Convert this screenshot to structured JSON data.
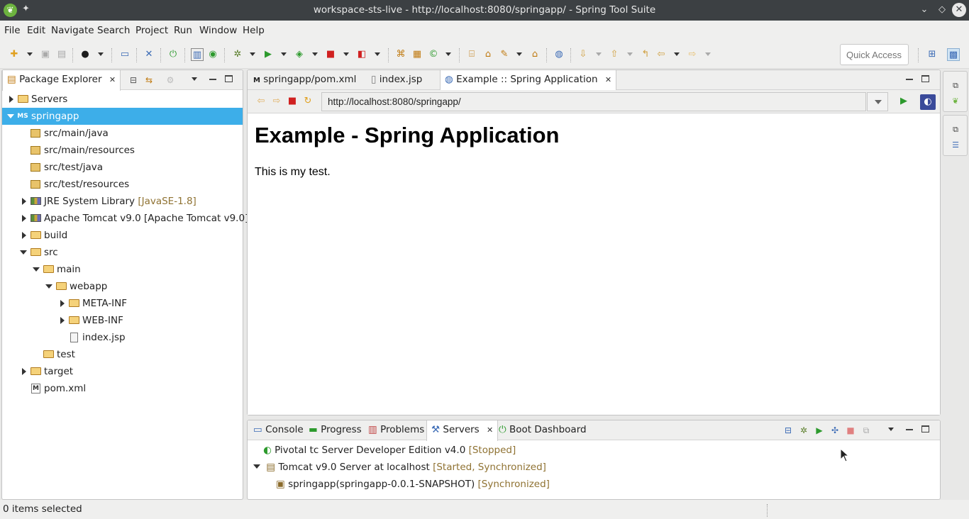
{
  "window": {
    "title": "workspace-sts-live - http://localhost:8080/springapp/ - Spring Tool Suite"
  },
  "menu": [
    "File",
    "Edit",
    "Navigate",
    "Search",
    "Project",
    "Run",
    "Window",
    "Help"
  ],
  "toolbar": {
    "quick_access_placeholder": "Quick Access"
  },
  "package_explorer": {
    "tab_label": "Package Explorer",
    "items": [
      {
        "label": "Servers",
        "decor": ""
      },
      {
        "label": "springapp",
        "decor": ""
      },
      {
        "label": "src/main/java",
        "decor": ""
      },
      {
        "label": "src/main/resources",
        "decor": ""
      },
      {
        "label": "src/test/java",
        "decor": ""
      },
      {
        "label": "src/test/resources",
        "decor": ""
      },
      {
        "label": "JRE System Library",
        "decor": "[JavaSE-1.8]"
      },
      {
        "label": "Apache Tomcat v9.0 [Apache Tomcat v9.0]",
        "decor": ""
      },
      {
        "label": "build",
        "decor": ""
      },
      {
        "label": "src",
        "decor": ""
      },
      {
        "label": "main",
        "decor": ""
      },
      {
        "label": "webapp",
        "decor": ""
      },
      {
        "label": "META-INF",
        "decor": ""
      },
      {
        "label": "WEB-INF",
        "decor": ""
      },
      {
        "label": "index.jsp",
        "decor": ""
      },
      {
        "label": "test",
        "decor": ""
      },
      {
        "label": "target",
        "decor": ""
      },
      {
        "label": "pom.xml",
        "decor": ""
      }
    ]
  },
  "editor": {
    "tabs": [
      {
        "label": "springapp/pom.xml"
      },
      {
        "label": "index.jsp"
      },
      {
        "label": "Example :: Spring Application"
      }
    ],
    "url": "http://localhost:8080/springapp/",
    "page_heading": "Example - Spring Application",
    "page_text": "This is my test."
  },
  "bottom_panel": {
    "tabs": [
      {
        "label": "Console"
      },
      {
        "label": "Progress"
      },
      {
        "label": "Problems"
      },
      {
        "label": "Servers"
      },
      {
        "label": "Boot Dashboard"
      }
    ],
    "servers": [
      {
        "name": "Pivotal tc Server Developer Edition v4.0",
        "status": "[Stopped]"
      },
      {
        "name": "Tomcat v9.0 Server at localhost",
        "status": "[Started, Synchronized]"
      },
      {
        "name": "springapp(springapp-0.0.1-SNAPSHOT)",
        "status": "[Synchronized]"
      }
    ]
  },
  "status_bar": {
    "text": "0 items selected"
  }
}
